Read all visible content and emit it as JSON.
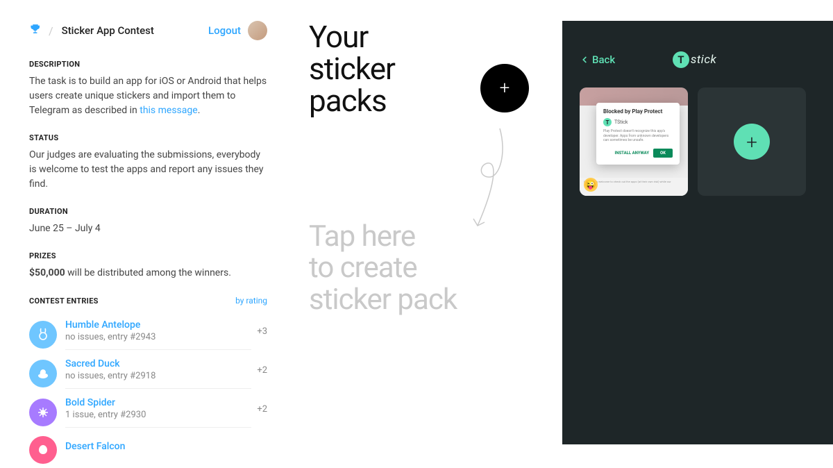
{
  "header": {
    "contest_title": "Sticker App Contest",
    "logout": "Logout",
    "slash": "/"
  },
  "sections": {
    "description_title": "DESCRIPTION",
    "description_body_prefix": "The task is to build an app for iOS or Android that helps users create unique stickers and import them to Telegram as described in ",
    "description_link": "this message",
    "description_body_suffix": ".",
    "status_title": "STATUS",
    "status_body": "Our judges are evaluating the submissions, everybody is welcome to test the apps and report any issues they find.",
    "duration_title": "DURATION",
    "duration_body": "June 25 – July 4",
    "prizes_title": "PRIZES",
    "prizes_bold": "$50,000",
    "prizes_rest": " will be distributed among the winners."
  },
  "entries_header": "CONTEST ENTRIES",
  "by_rating": "by rating",
  "entries": [
    {
      "name": "Humble Antelope",
      "meta": "no issues, entry #2943",
      "score": "+3",
      "color": "#6fc6ff"
    },
    {
      "name": "Sacred Duck",
      "meta": "no issues, entry #2918",
      "score": "+2",
      "color": "#6fc6ff"
    },
    {
      "name": "Bold Spider",
      "meta": "1 issue, entry #2930",
      "score": "+2",
      "color": "#a77bff"
    },
    {
      "name": "Desert Falcon",
      "meta": "",
      "score": "",
      "color": "#ff5f8f"
    }
  ],
  "middle": {
    "title_l1": "Your",
    "title_l2": "sticker",
    "title_l3": "packs",
    "tap_l1": "Tap here",
    "tap_l2": "to create",
    "tap_l3": "sticker pack"
  },
  "right": {
    "back": "Back",
    "logo_letter": "T",
    "logo_text": "stick",
    "dialog_title": "Blocked by Play Protect",
    "dialog_app": "TStick",
    "dialog_desc": "Play Protect doesn't recognize this app's developer. Apps from unknown developers can sometimes be unsafe.",
    "install_anyway": "INSTALL ANYWAY",
    "ok": "OK",
    "footer_text": "Everyone is welcome to check out the apps (at their own risk) while our"
  }
}
